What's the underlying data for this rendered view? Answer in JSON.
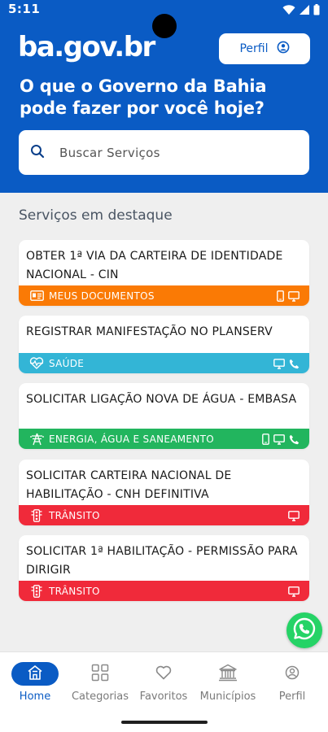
{
  "status": {
    "time": "5:11"
  },
  "header": {
    "logo": "ba.gov.br",
    "perfil_button": "Perfil",
    "headline": "O que o Governo da Bahia pode fazer por você hoje?",
    "brand_color": "#0a5bc4"
  },
  "search": {
    "placeholder": "Buscar Serviços",
    "value": ""
  },
  "section": {
    "title": "Serviços em destaque"
  },
  "services": [
    {
      "title": "OBTER 1ª VIA DA CARTEIRA DE IDENTIDADE NACIONAL - CIN",
      "category": "MEUS DOCUMENTOS",
      "category_icon": "id-card-icon",
      "color": "#fa7a05",
      "channels": [
        "phone-icon",
        "desktop-icon"
      ]
    },
    {
      "title": "REGISTRAR MANIFESTAÇÃO NO PLANSERV",
      "category": "SAÚDE",
      "category_icon": "heartbeat-icon",
      "color": "#33b5d6",
      "channels": [
        "desktop-icon",
        "call-icon"
      ]
    },
    {
      "title": "SOLICITAR LIGAÇÃO NOVA DE ÁGUA - EMBASA",
      "category": "ENERGIA, ÁGUA E SANEAMENTO",
      "category_icon": "tower-icon",
      "color": "#22b55e",
      "channels": [
        "phone-icon",
        "desktop-icon",
        "call-icon"
      ]
    },
    {
      "title": "SOLICITAR CARTEIRA NACIONAL DE HABILITAÇÃO - CNH DEFINITIVA",
      "category": "TRÂNSITO",
      "category_icon": "traffic-light-icon",
      "color": "#f02a3a",
      "channels": [
        "desktop-icon"
      ]
    },
    {
      "title": "SOLICITAR 1ª HABILITAÇÃO - PERMISSÃO PARA DIRIGIR",
      "category": "TRÂNSITO",
      "category_icon": "traffic-light-icon",
      "color": "#f02a3a",
      "channels": [
        "desktop-icon"
      ]
    }
  ],
  "nav": [
    {
      "label": "Home",
      "icon": "home-icon",
      "active": true
    },
    {
      "label": "Categorias",
      "icon": "grid-icon",
      "active": false
    },
    {
      "label": "Favoritos",
      "icon": "heart-icon",
      "active": false
    },
    {
      "label": "Municípios",
      "icon": "building-icon",
      "active": false
    },
    {
      "label": "Perfil",
      "icon": "user-icon",
      "active": false
    }
  ]
}
